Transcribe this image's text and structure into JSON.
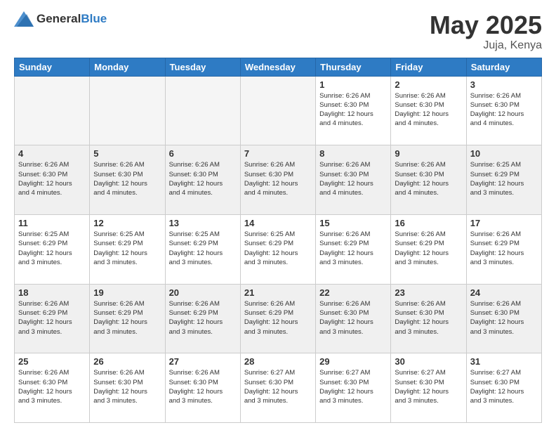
{
  "header": {
    "logo_general": "General",
    "logo_blue": "Blue",
    "month_year": "May 2025",
    "location": "Juja, Kenya"
  },
  "days_of_week": [
    "Sunday",
    "Monday",
    "Tuesday",
    "Wednesday",
    "Thursday",
    "Friday",
    "Saturday"
  ],
  "weeks": [
    [
      {
        "day": "",
        "info": "",
        "empty": true
      },
      {
        "day": "",
        "info": "",
        "empty": true
      },
      {
        "day": "",
        "info": "",
        "empty": true
      },
      {
        "day": "",
        "info": "",
        "empty": true
      },
      {
        "day": "1",
        "info": "Sunrise: 6:26 AM\nSunset: 6:30 PM\nDaylight: 12 hours\nand 4 minutes.",
        "empty": false
      },
      {
        "day": "2",
        "info": "Sunrise: 6:26 AM\nSunset: 6:30 PM\nDaylight: 12 hours\nand 4 minutes.",
        "empty": false
      },
      {
        "day": "3",
        "info": "Sunrise: 6:26 AM\nSunset: 6:30 PM\nDaylight: 12 hours\nand 4 minutes.",
        "empty": false
      }
    ],
    [
      {
        "day": "4",
        "info": "Sunrise: 6:26 AM\nSunset: 6:30 PM\nDaylight: 12 hours\nand 4 minutes.",
        "empty": false
      },
      {
        "day": "5",
        "info": "Sunrise: 6:26 AM\nSunset: 6:30 PM\nDaylight: 12 hours\nand 4 minutes.",
        "empty": false
      },
      {
        "day": "6",
        "info": "Sunrise: 6:26 AM\nSunset: 6:30 PM\nDaylight: 12 hours\nand 4 minutes.",
        "empty": false
      },
      {
        "day": "7",
        "info": "Sunrise: 6:26 AM\nSunset: 6:30 PM\nDaylight: 12 hours\nand 4 minutes.",
        "empty": false
      },
      {
        "day": "8",
        "info": "Sunrise: 6:26 AM\nSunset: 6:30 PM\nDaylight: 12 hours\nand 4 minutes.",
        "empty": false
      },
      {
        "day": "9",
        "info": "Sunrise: 6:26 AM\nSunset: 6:30 PM\nDaylight: 12 hours\nand 4 minutes.",
        "empty": false
      },
      {
        "day": "10",
        "info": "Sunrise: 6:25 AM\nSunset: 6:29 PM\nDaylight: 12 hours\nand 3 minutes.",
        "empty": false
      }
    ],
    [
      {
        "day": "11",
        "info": "Sunrise: 6:25 AM\nSunset: 6:29 PM\nDaylight: 12 hours\nand 3 minutes.",
        "empty": false
      },
      {
        "day": "12",
        "info": "Sunrise: 6:25 AM\nSunset: 6:29 PM\nDaylight: 12 hours\nand 3 minutes.",
        "empty": false
      },
      {
        "day": "13",
        "info": "Sunrise: 6:25 AM\nSunset: 6:29 PM\nDaylight: 12 hours\nand 3 minutes.",
        "empty": false
      },
      {
        "day": "14",
        "info": "Sunrise: 6:25 AM\nSunset: 6:29 PM\nDaylight: 12 hours\nand 3 minutes.",
        "empty": false
      },
      {
        "day": "15",
        "info": "Sunrise: 6:26 AM\nSunset: 6:29 PM\nDaylight: 12 hours\nand 3 minutes.",
        "empty": false
      },
      {
        "day": "16",
        "info": "Sunrise: 6:26 AM\nSunset: 6:29 PM\nDaylight: 12 hours\nand 3 minutes.",
        "empty": false
      },
      {
        "day": "17",
        "info": "Sunrise: 6:26 AM\nSunset: 6:29 PM\nDaylight: 12 hours\nand 3 minutes.",
        "empty": false
      }
    ],
    [
      {
        "day": "18",
        "info": "Sunrise: 6:26 AM\nSunset: 6:29 PM\nDaylight: 12 hours\nand 3 minutes.",
        "empty": false
      },
      {
        "day": "19",
        "info": "Sunrise: 6:26 AM\nSunset: 6:29 PM\nDaylight: 12 hours\nand 3 minutes.",
        "empty": false
      },
      {
        "day": "20",
        "info": "Sunrise: 6:26 AM\nSunset: 6:29 PM\nDaylight: 12 hours\nand 3 minutes.",
        "empty": false
      },
      {
        "day": "21",
        "info": "Sunrise: 6:26 AM\nSunset: 6:29 PM\nDaylight: 12 hours\nand 3 minutes.",
        "empty": false
      },
      {
        "day": "22",
        "info": "Sunrise: 6:26 AM\nSunset: 6:30 PM\nDaylight: 12 hours\nand 3 minutes.",
        "empty": false
      },
      {
        "day": "23",
        "info": "Sunrise: 6:26 AM\nSunset: 6:30 PM\nDaylight: 12 hours\nand 3 minutes.",
        "empty": false
      },
      {
        "day": "24",
        "info": "Sunrise: 6:26 AM\nSunset: 6:30 PM\nDaylight: 12 hours\nand 3 minutes.",
        "empty": false
      }
    ],
    [
      {
        "day": "25",
        "info": "Sunrise: 6:26 AM\nSunset: 6:30 PM\nDaylight: 12 hours\nand 3 minutes.",
        "empty": false
      },
      {
        "day": "26",
        "info": "Sunrise: 6:26 AM\nSunset: 6:30 PM\nDaylight: 12 hours\nand 3 minutes.",
        "empty": false
      },
      {
        "day": "27",
        "info": "Sunrise: 6:26 AM\nSunset: 6:30 PM\nDaylight: 12 hours\nand 3 minutes.",
        "empty": false
      },
      {
        "day": "28",
        "info": "Sunrise: 6:27 AM\nSunset: 6:30 PM\nDaylight: 12 hours\nand 3 minutes.",
        "empty": false
      },
      {
        "day": "29",
        "info": "Sunrise: 6:27 AM\nSunset: 6:30 PM\nDaylight: 12 hours\nand 3 minutes.",
        "empty": false
      },
      {
        "day": "30",
        "info": "Sunrise: 6:27 AM\nSunset: 6:30 PM\nDaylight: 12 hours\nand 3 minutes.",
        "empty": false
      },
      {
        "day": "31",
        "info": "Sunrise: 6:27 AM\nSunset: 6:30 PM\nDaylight: 12 hours\nand 3 minutes.",
        "empty": false
      }
    ]
  ]
}
